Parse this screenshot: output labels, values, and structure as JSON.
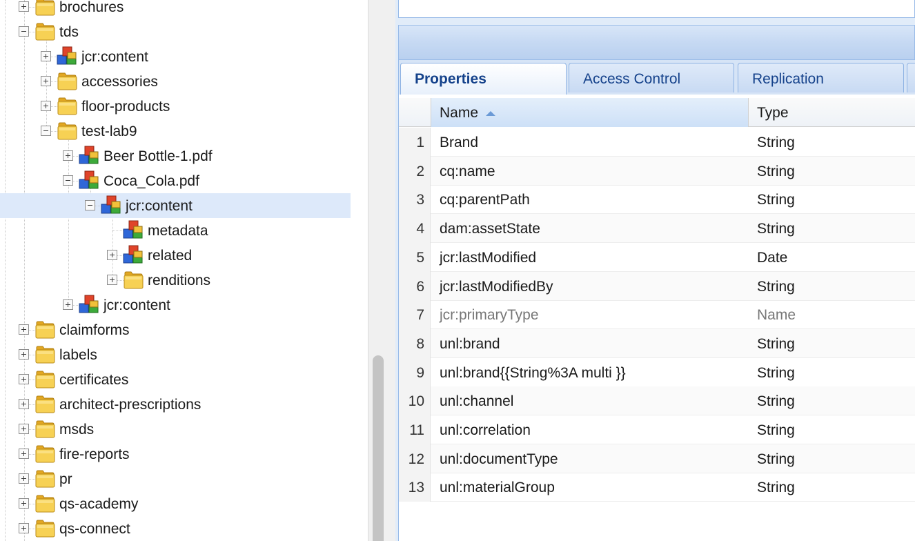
{
  "tree": {
    "nodes": [
      {
        "label": "brochures",
        "icon": "folder-icon",
        "toggle": "plus"
      },
      {
        "label": "tds",
        "icon": "folder-icon",
        "toggle": "minus"
      },
      {
        "label": "jcr:content",
        "icon": "node-icon",
        "toggle": "plus"
      },
      {
        "label": "accessories",
        "icon": "folder-icon",
        "toggle": "plus"
      },
      {
        "label": "floor-products",
        "icon": "folder-icon",
        "toggle": "plus"
      },
      {
        "label": "test-lab9",
        "icon": "folder-icon",
        "toggle": "minus"
      },
      {
        "label": "Beer Bottle-1.pdf",
        "icon": "node-icon",
        "toggle": "plus"
      },
      {
        "label": "Coca_Cola.pdf",
        "icon": "node-icon",
        "toggle": "minus"
      },
      {
        "label": "jcr:content",
        "icon": "node-icon",
        "toggle": "minus",
        "selected": true
      },
      {
        "label": "metadata",
        "icon": "node-icon",
        "toggle": "none"
      },
      {
        "label": "related",
        "icon": "node-icon",
        "toggle": "plus"
      },
      {
        "label": "renditions",
        "icon": "folder-icon",
        "toggle": "plus"
      },
      {
        "label": "jcr:content",
        "icon": "node-icon",
        "toggle": "plus"
      },
      {
        "label": "claimforms",
        "icon": "folder-icon",
        "toggle": "plus"
      },
      {
        "label": "labels",
        "icon": "folder-icon",
        "toggle": "plus"
      },
      {
        "label": "certificates",
        "icon": "folder-icon",
        "toggle": "plus"
      },
      {
        "label": "architect-prescriptions",
        "icon": "folder-icon",
        "toggle": "plus"
      },
      {
        "label": "msds",
        "icon": "folder-icon",
        "toggle": "plus"
      },
      {
        "label": "fire-reports",
        "icon": "folder-icon",
        "toggle": "plus"
      },
      {
        "label": "pr",
        "icon": "folder-icon",
        "toggle": "plus"
      },
      {
        "label": "qs-academy",
        "icon": "folder-icon",
        "toggle": "plus"
      },
      {
        "label": "qs-connect",
        "icon": "folder-icon",
        "toggle": "plus"
      }
    ]
  },
  "tabs": [
    "Properties",
    "Access Control",
    "Replication"
  ],
  "active_tab": "Properties",
  "grid": {
    "columns": {
      "name": "Name",
      "type": "Type"
    },
    "sort_column": "Name",
    "sort_direction": "ascending",
    "rows": [
      {
        "num": "1",
        "name": "Brand",
        "type": "String"
      },
      {
        "num": "2",
        "name": "cq:name",
        "type": "String"
      },
      {
        "num": "3",
        "name": "cq:parentPath",
        "type": "String"
      },
      {
        "num": "4",
        "name": "dam:assetState",
        "type": "String"
      },
      {
        "num": "5",
        "name": "jcr:lastModified",
        "type": "Date"
      },
      {
        "num": "6",
        "name": "jcr:lastModifiedBy",
        "type": "String"
      },
      {
        "num": "7",
        "name": "jcr:primaryType",
        "type": "Name",
        "dim": true
      },
      {
        "num": "8",
        "name": "unl:brand",
        "type": "String"
      },
      {
        "num": "9",
        "name": "unl:brand{{String%3A multi }}",
        "type": "String"
      },
      {
        "num": "10",
        "name": "unl:channel",
        "type": "String"
      },
      {
        "num": "11",
        "name": "unl:correlation",
        "type": "String"
      },
      {
        "num": "12",
        "name": "unl:documentType",
        "type": "String"
      },
      {
        "num": "13",
        "name": "unl:materialGroup",
        "type": "String"
      }
    ]
  },
  "colors": {
    "selection": "#dde9fa",
    "tab_text": "#15428b",
    "panel_border": "#99bbe8",
    "folder": "#f4c542",
    "node_red": "#e0442a",
    "node_green": "#3daa3a",
    "node_blue": "#2f67d8"
  }
}
